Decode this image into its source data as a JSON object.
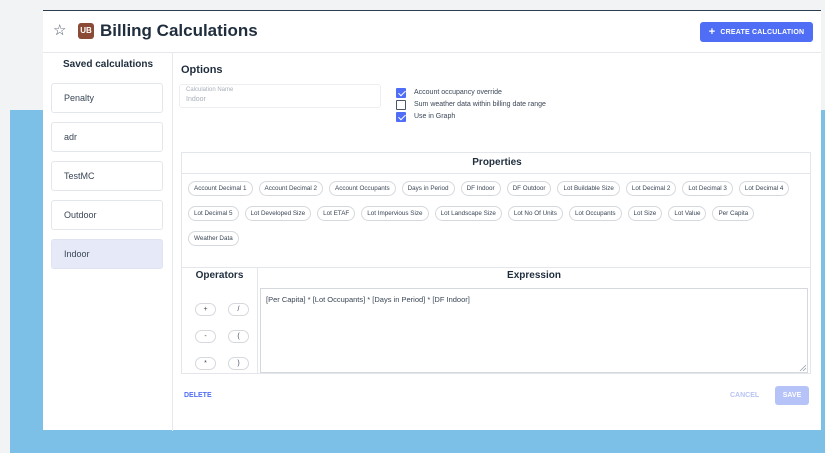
{
  "header": {
    "title": "Billing Calculations",
    "badge": "UB",
    "create_label": "CREATE CALCULATION"
  },
  "sidebar": {
    "title": "Saved calculations",
    "items": [
      {
        "label": "Penalty",
        "active": false
      },
      {
        "label": "adr",
        "active": false
      },
      {
        "label": "TestMC",
        "active": false
      },
      {
        "label": "Outdoor",
        "active": false
      },
      {
        "label": "Indoor",
        "active": true
      }
    ]
  },
  "options": {
    "title": "Options",
    "name_label": "Calculation Name",
    "name_value": "Indoor",
    "checks": [
      {
        "label": "Account occupancy override",
        "checked": true
      },
      {
        "label": "Sum weather data within billing date range",
        "checked": false
      },
      {
        "label": "Use in Graph",
        "checked": true
      }
    ]
  },
  "properties": {
    "title": "Properties",
    "chips": [
      "Account Decimal 1",
      "Account Decimal 2",
      "Account Occupants",
      "Days in Period",
      "DF Indoor",
      "DF Outdoor",
      "Lot Buildable Size",
      "Lot Decimal 2",
      "Lot Decimal 3",
      "Lot Decimal 4",
      "Lot Decimal 5",
      "Lot Developed Size",
      "Lot ETAF",
      "Lot Impervious Size",
      "Lot Landscape Size",
      "Lot No Of Units",
      "Lot Occupants",
      "Lot Size",
      "Lot Value",
      "Per Capita",
      "Weather Data"
    ]
  },
  "operators": {
    "title": "Operators",
    "buttons": [
      "+",
      "/",
      "-",
      "(",
      "*",
      ")"
    ]
  },
  "expression": {
    "title": "Expression",
    "value": "[Per Capita] * [Lot Occupants] * [Days in Period] * [DF Indoor]"
  },
  "footer": {
    "delete_label": "DELETE",
    "cancel_label": "CANCEL",
    "save_label": "SAVE"
  },
  "colors": {
    "accent": "#4f6ef5",
    "badge": "#8b4a36",
    "backdrop": "#7cc0e8"
  }
}
